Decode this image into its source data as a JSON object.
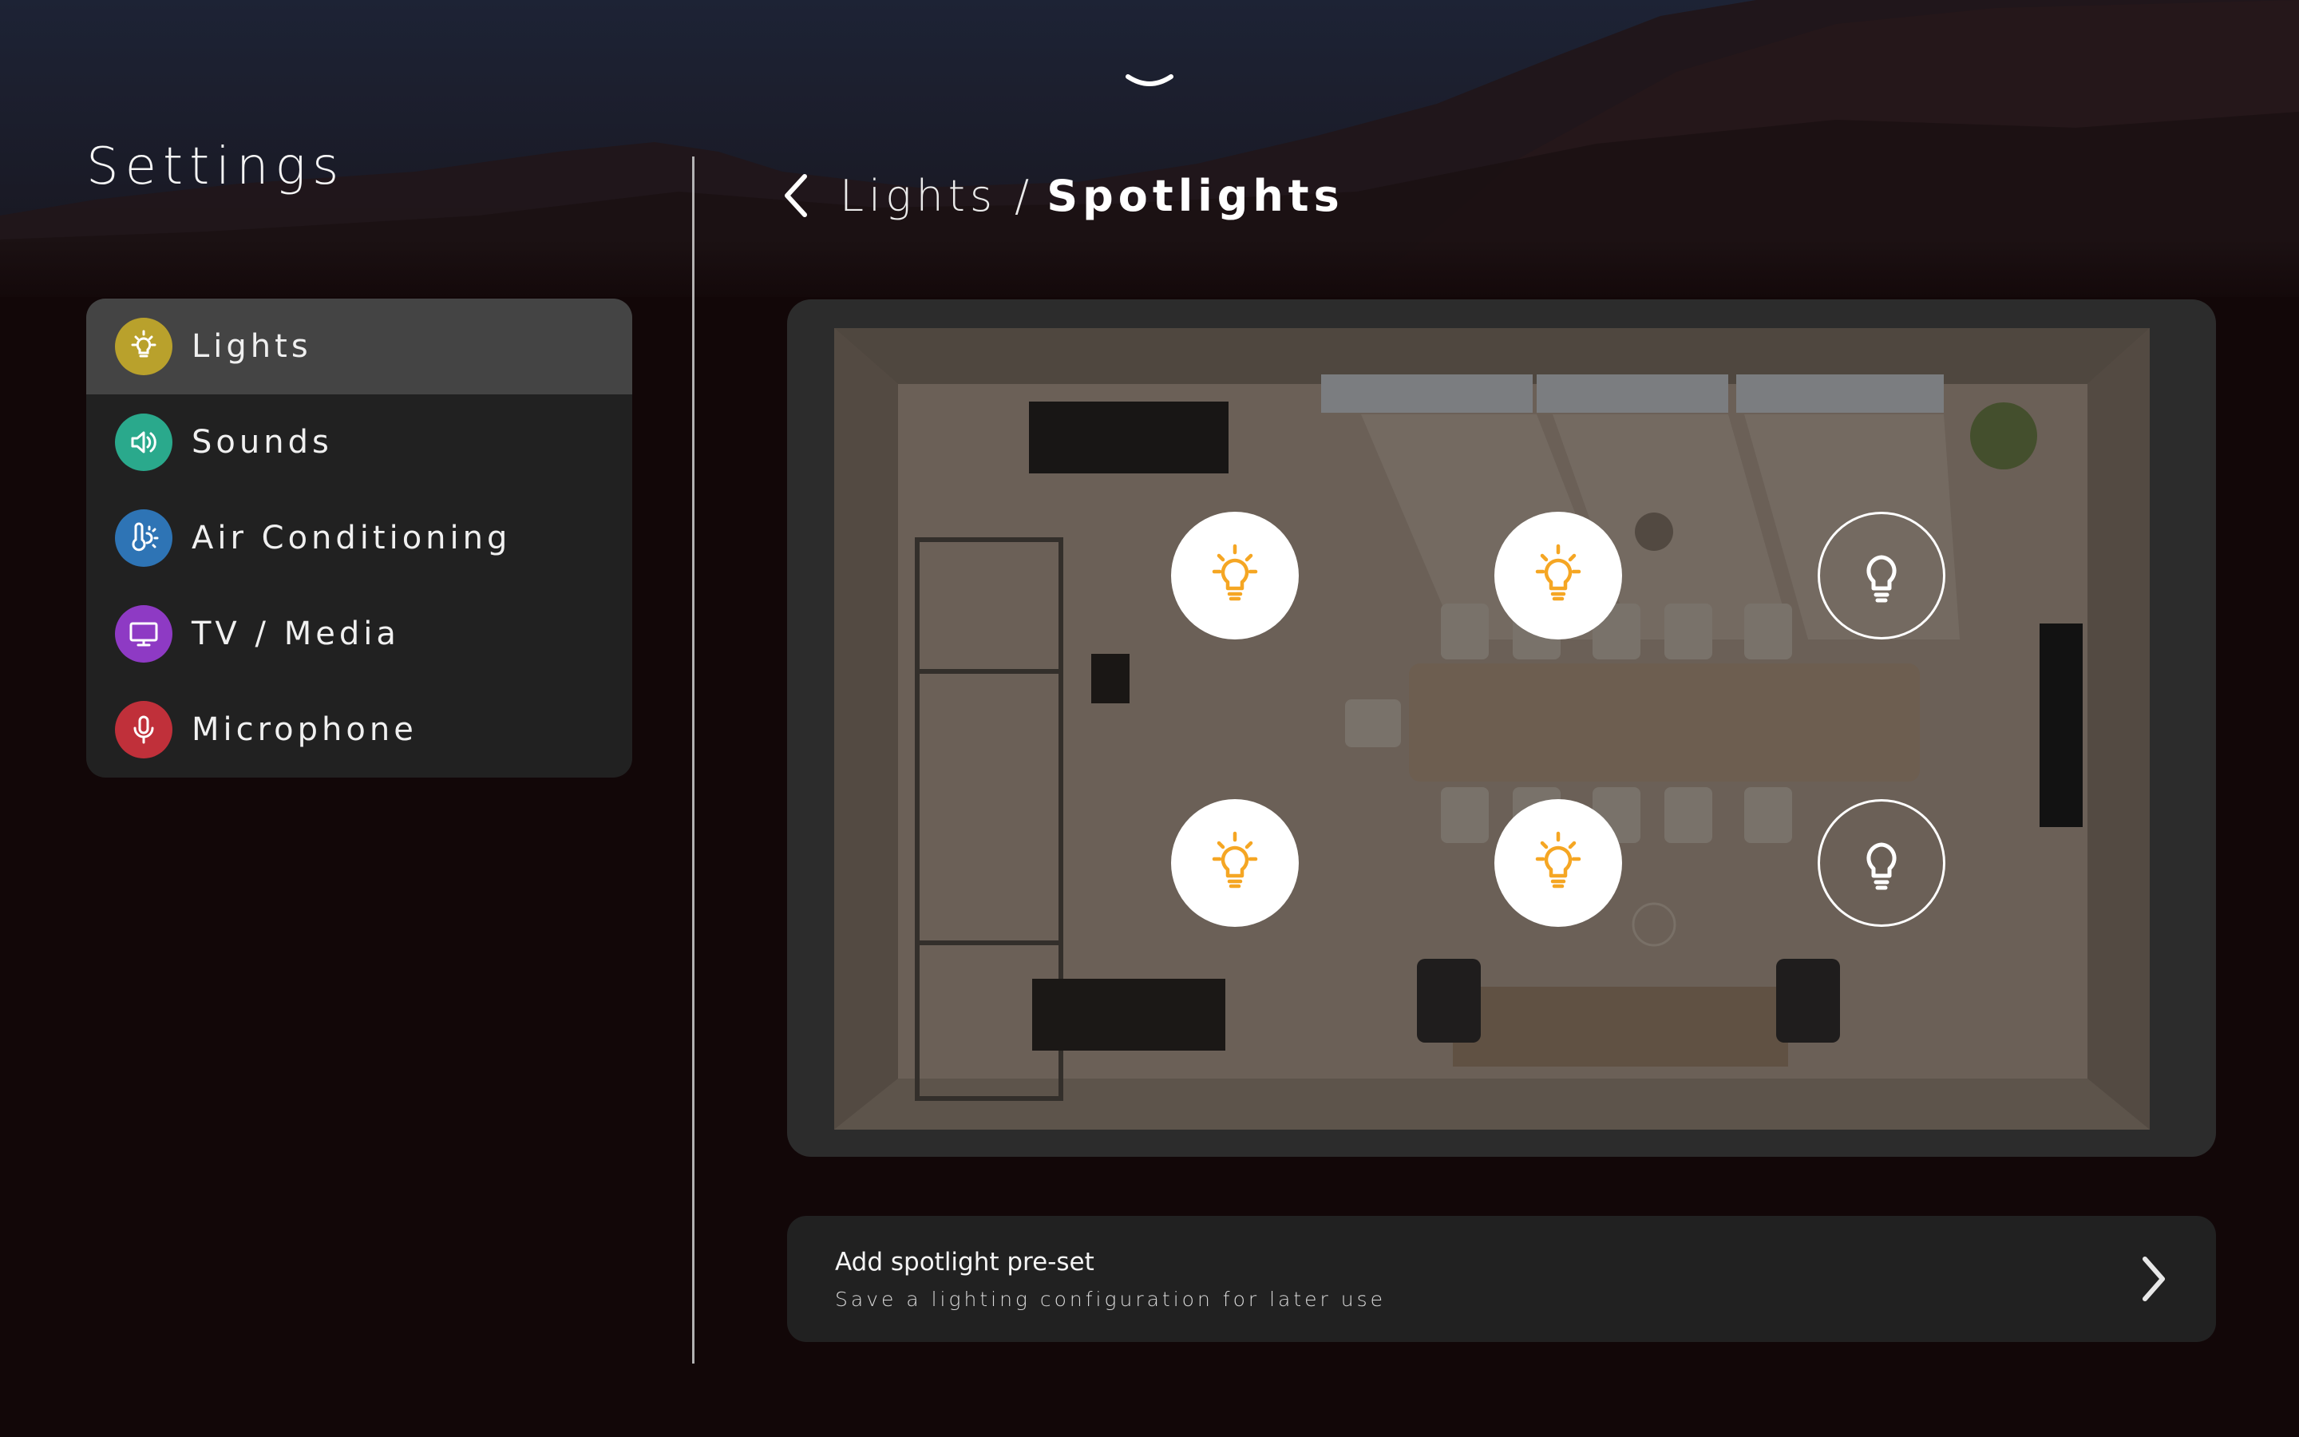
{
  "settings_title": "Settings",
  "menu": {
    "items": [
      {
        "label": "Lights",
        "icon": "lightbulb-icon",
        "color": "#b9a12c",
        "active": true
      },
      {
        "label": "Sounds",
        "icon": "speaker-icon",
        "color": "#2aa98c",
        "active": false
      },
      {
        "label": "Air Conditioning",
        "icon": "thermometer-sun-icon",
        "color": "#2e74b5",
        "active": false
      },
      {
        "label": "TV / Media",
        "icon": "monitor-icon",
        "color": "#8e3ac4",
        "active": false
      },
      {
        "label": "Microphone",
        "icon": "microphone-icon",
        "color": "#c0303a",
        "active": false
      }
    ]
  },
  "breadcrumb": {
    "parent": "Lights",
    "separator": "/",
    "current": "Spotlights"
  },
  "spotlights": [
    {
      "row": 1,
      "col": 1,
      "state": "on"
    },
    {
      "row": 1,
      "col": 2,
      "state": "on"
    },
    {
      "row": 1,
      "col": 3,
      "state": "off"
    },
    {
      "row": 2,
      "col": 1,
      "state": "on"
    },
    {
      "row": 2,
      "col": 2,
      "state": "on"
    },
    {
      "row": 2,
      "col": 3,
      "state": "off"
    }
  ],
  "preset": {
    "title": "Add spotlight pre-set",
    "subtitle": "Save a lighting configuration for later use"
  },
  "colors": {
    "accent_on": "#f5a623",
    "background": "#120708",
    "panel": "#2c2c2c",
    "card": "#212121",
    "menu_active": "#444444"
  }
}
